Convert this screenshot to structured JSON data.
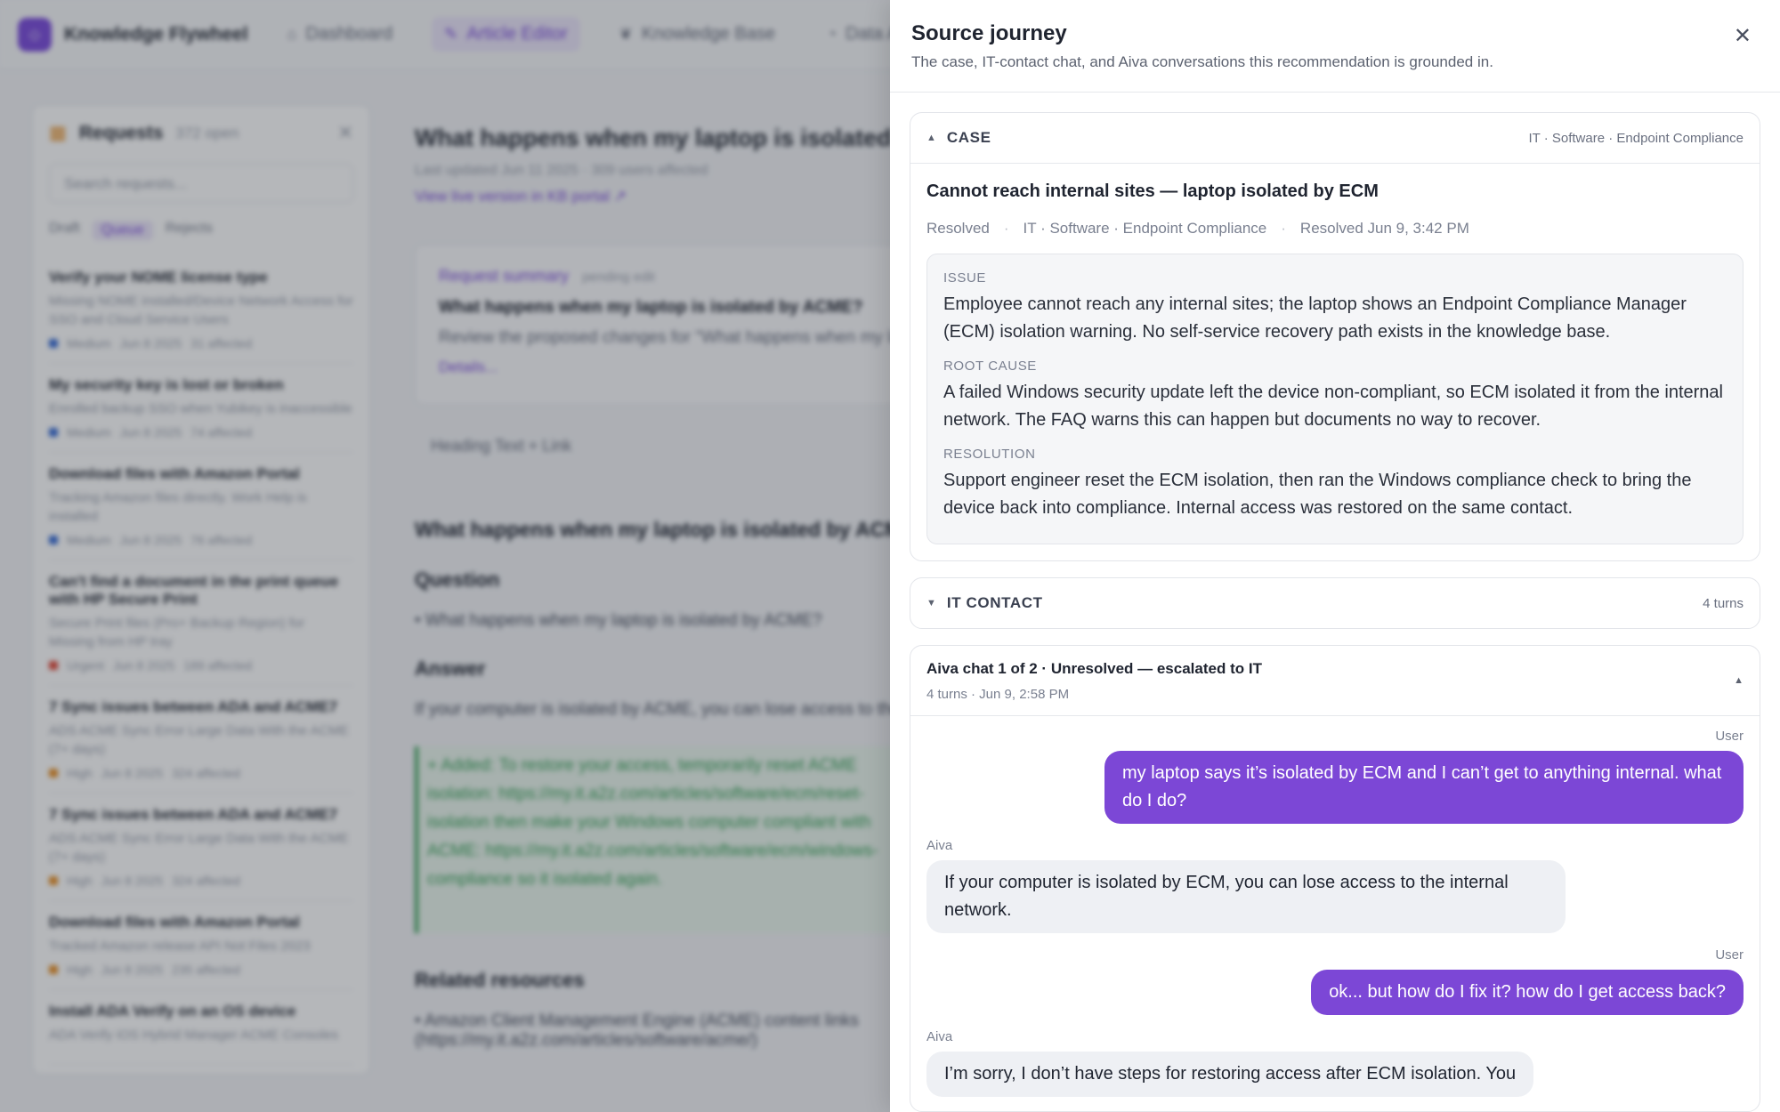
{
  "app": {
    "brand": "Knowledge Flywheel",
    "nav": [
      {
        "icon": "⌂",
        "label": "Dashboard"
      },
      {
        "icon": "✎",
        "label": "Article Editor"
      },
      {
        "icon": "❦",
        "label": "Knowledge Base"
      },
      {
        "icon": "◔",
        "label": "Data Analys"
      }
    ]
  },
  "requests_panel": {
    "title": "Requests",
    "count": "372 open",
    "search_placeholder": "Search requests...",
    "filters": [
      "Draft",
      "Queue",
      "Rejects"
    ],
    "items": [
      {
        "title": "Verify your NOME license type",
        "desc": "Missing NOME installed/Device Network Access for SSO and Cloud Service Users",
        "meta": [
          "Medium",
          "Jun 8 2025",
          "31 affected"
        ],
        "color": "#3b6fd6"
      },
      {
        "title": "My security key is lost or broken",
        "desc": "Enrolled backup SSO when Yubikey is inaccessible",
        "meta": [
          "Medium",
          "Jun 8 2025",
          "74 affected"
        ],
        "color": "#3b6fd6"
      },
      {
        "title": "Download files with Amazon Portal",
        "desc": "Tracking Amazon files directly. Work Help is installed",
        "meta": [
          "Medium",
          "Jun 8 2025",
          "76 affected"
        ],
        "color": "#3b6fd6"
      },
      {
        "title": "Can't find a document in the print queue with HP Secure Print",
        "desc": "Secure Print files (Pro+ Backup Region) for Missing from HP tray",
        "meta": [
          "Urgent",
          "Jun 8 2025",
          "189 affected"
        ],
        "color": "#e04b3c"
      },
      {
        "title": "7 Sync issues between ADA and ACME7",
        "desc": "ADS ACME Sync Error Large Data With the ACME (7+ days)",
        "meta": [
          "High",
          "Jun 8 2025",
          "324 affected"
        ],
        "color": "#e8922b"
      },
      {
        "title": "7 Sync issues between ADA and ACME7",
        "desc": "ADS ACME Sync Error Large Data With the ACME (7+ days)",
        "meta": [
          "High",
          "Jun 8 2025",
          "324 affected"
        ],
        "color": "#e8922b"
      },
      {
        "title": "Download files with Amazon Portal",
        "desc": "Tracked Amazon release API Not Files 2023",
        "meta": [
          "High",
          "Jun 8 2025",
          "235 affected"
        ],
        "color": "#e8922b"
      },
      {
        "title": "Install ADA Verify on an OS device",
        "desc": "ADA Verify iOS Hybrid Manager ACME Consoles",
        "meta": [],
        "color": "#3b6fd6"
      }
    ]
  },
  "editor": {
    "title": "What happens when my laptop is isolated by ACME?",
    "updated": "Last updated Jun 11 2025 · 309 users affected",
    "link": "View live version in KB portal ↗",
    "summary_label": "Request summary",
    "summary_status": "pending edit",
    "summary_title": "What happens when my laptop is isolated by ACME?",
    "summary_text": "Review the proposed changes for \"What happens when my laptop...",
    "summary_link": "Details...",
    "toolbar": "Heading   Text   + Link",
    "doc_heading": "What happens when my laptop is isolated by ACME?",
    "question_label": "Question",
    "question_text": "• What happens when my laptop is isolated by ACME?",
    "answer_label": "Answer",
    "answer_text": "If your computer is isolated by ACME, you can lose access to the internal network.",
    "green_text": "+ Added: To restore your access, temporarily reset ACME isolation: https://my.it.a2z.com/articles/software/ecm/reset-isolation then make your Windows computer compliant with ACME: https://my.it.a2z.com/articles/software/ecm/windows-compliance so it isolated again.",
    "related_label": "Related resources",
    "related_text": "• Amazon Client Management Engine (ACME) content links (https://my.it.a2z.com/articles/software/acme/)"
  },
  "drawer": {
    "title": "Source journey",
    "subtitle": "The case, IT-contact chat, and Aiva conversations this recommendation is grounded in.",
    "close_glyph": "✕",
    "case": {
      "label": "CASE",
      "category": "IT · Software · Endpoint Compliance",
      "title": "Cannot reach internal sites — laptop isolated by ECM",
      "status": "Resolved",
      "category_meta": "IT · Software · Endpoint Compliance",
      "resolved_at": "Resolved Jun 9, 3:42 PM",
      "issue_label": "ISSUE",
      "issue_text": "Employee cannot reach any internal sites; the laptop shows an Endpoint Compliance Manager (ECM) isolation warning. No self-service recovery path exists in the knowledge base.",
      "root_label": "ROOT CAUSE",
      "root_text": "A failed Windows security update left the device non-compliant, so ECM isolated it from the internal network. The FAQ warns this can happen but documents no way to recover.",
      "resolution_label": "RESOLUTION",
      "resolution_text": "Support engineer reset the ECM isolation, then ran the Windows compliance check to bring the device back into compliance. Internal access was restored on the same contact."
    },
    "it_contact": {
      "label": "IT CONTACT",
      "turns": "4 turns"
    },
    "aiva_chat": {
      "title": "Aiva chat 1 of 2 · Unresolved — escalated to IT",
      "sub": "4 turns · Jun 9, 2:58 PM",
      "messages": [
        {
          "sender": "User",
          "text": "my laptop says it’s isolated by ECM and I can’t get to anything internal. what do I do?"
        },
        {
          "sender": "Aiva",
          "text": "If your computer is isolated by ECM, you can lose access to the internal network."
        },
        {
          "sender": "User",
          "text": "ok... but how do I fix it? how do I get access back?"
        },
        {
          "sender": "Aiva",
          "text": "I’m sorry, I don’t have steps for restoring access after ECM isolation. You"
        }
      ]
    }
  }
}
